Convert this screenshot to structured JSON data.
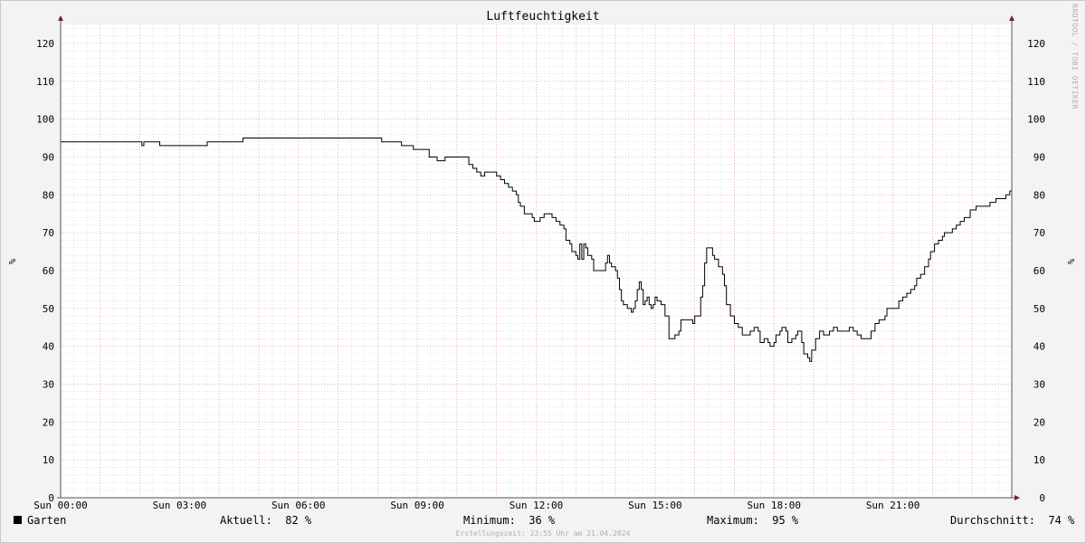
{
  "page": {
    "title": "Luftfeuchtigkeit",
    "credit": "RRDTOOL / TOBI OETIKER",
    "timestamp": "Erstellungszeit: 23:55 Uhr am 21.04.2024"
  },
  "legend": {
    "series_name": "Garten",
    "current": "Aktuell:  82 %",
    "minimum": "Minimum:  36 %",
    "maximum": "Maximum:  95 %",
    "average": "Durchschnitt:  74 %"
  },
  "colors": {
    "background": "#f3f3f3",
    "plot_area": "#ffffff",
    "line": "#000000",
    "major_grid": "#e5a0a0",
    "minor_grid": "#d0d0d0",
    "axis_arrow": "#7f1d1d"
  },
  "chart_data": {
    "type": "line",
    "title": "Luftfeuchtigkeit",
    "ylabel": "%",
    "ylim": [
      0,
      125
    ],
    "yticks": [
      0,
      10,
      20,
      30,
      40,
      50,
      60,
      70,
      80,
      90,
      100,
      110,
      120
    ],
    "xlim": [
      0,
      24
    ],
    "x_unit": "hours",
    "xticks": [
      {
        "x": 0,
        "label": "Sun 00:00"
      },
      {
        "x": 3,
        "label": "Sun 03:00"
      },
      {
        "x": 6,
        "label": "Sun 06:00"
      },
      {
        "x": 9,
        "label": "Sun 09:00"
      },
      {
        "x": 12,
        "label": "Sun 12:00"
      },
      {
        "x": 15,
        "label": "Sun 15:00"
      },
      {
        "x": 18,
        "label": "Sun 18:00"
      },
      {
        "x": 21,
        "label": "Sun 21:00"
      }
    ],
    "grid": true,
    "series": [
      {
        "name": "Garten",
        "color": "#000000",
        "step": true,
        "points": [
          [
            0,
            94
          ],
          [
            2.0,
            94
          ],
          [
            2.05,
            93
          ],
          [
            2.1,
            94
          ],
          [
            2.5,
            94
          ],
          [
            2.5,
            93
          ],
          [
            3.6,
            93
          ],
          [
            3.7,
            94
          ],
          [
            4.6,
            94
          ],
          [
            4.6,
            95
          ],
          [
            8.1,
            95
          ],
          [
            8.1,
            94
          ],
          [
            8.6,
            94
          ],
          [
            8.6,
            93
          ],
          [
            8.9,
            93
          ],
          [
            8.9,
            92
          ],
          [
            9.3,
            92
          ],
          [
            9.3,
            90
          ],
          [
            9.5,
            90
          ],
          [
            9.5,
            89
          ],
          [
            9.7,
            89
          ],
          [
            9.7,
            90
          ],
          [
            10.2,
            90
          ],
          [
            10.3,
            88
          ],
          [
            10.4,
            87
          ],
          [
            10.5,
            86
          ],
          [
            10.6,
            85
          ],
          [
            10.7,
            86
          ],
          [
            10.9,
            86
          ],
          [
            11.0,
            85
          ],
          [
            11.1,
            84
          ],
          [
            11.2,
            83
          ],
          [
            11.3,
            82
          ],
          [
            11.4,
            81
          ],
          [
            11.5,
            80
          ],
          [
            11.55,
            78
          ],
          [
            11.6,
            77
          ],
          [
            11.7,
            75
          ],
          [
            11.9,
            74
          ],
          [
            11.95,
            73
          ],
          [
            12.1,
            73
          ],
          [
            12.1,
            74
          ],
          [
            12.2,
            75
          ],
          [
            12.4,
            74
          ],
          [
            12.5,
            73
          ],
          [
            12.6,
            72
          ],
          [
            12.7,
            71
          ],
          [
            12.75,
            68
          ],
          [
            12.85,
            67
          ],
          [
            12.9,
            65
          ],
          [
            13.0,
            64
          ],
          [
            13.05,
            63
          ],
          [
            13.1,
            67
          ],
          [
            13.15,
            63
          ],
          [
            13.2,
            67
          ],
          [
            13.25,
            66
          ],
          [
            13.3,
            64
          ],
          [
            13.4,
            63
          ],
          [
            13.45,
            60
          ],
          [
            13.7,
            60
          ],
          [
            13.75,
            62
          ],
          [
            13.8,
            64
          ],
          [
            13.85,
            62
          ],
          [
            13.9,
            61
          ],
          [
            14.0,
            60
          ],
          [
            14.05,
            58
          ],
          [
            14.1,
            55
          ],
          [
            14.15,
            52
          ],
          [
            14.2,
            51
          ],
          [
            14.3,
            50
          ],
          [
            14.4,
            49
          ],
          [
            14.45,
            50
          ],
          [
            14.5,
            52
          ],
          [
            14.55,
            55
          ],
          [
            14.6,
            57
          ],
          [
            14.65,
            55
          ],
          [
            14.7,
            51
          ],
          [
            14.75,
            52
          ],
          [
            14.8,
            53
          ],
          [
            14.85,
            51
          ],
          [
            14.9,
            50
          ],
          [
            14.95,
            51
          ],
          [
            15.0,
            53
          ],
          [
            15.05,
            52
          ],
          [
            15.15,
            51
          ],
          [
            15.25,
            48
          ],
          [
            15.35,
            42
          ],
          [
            15.5,
            43
          ],
          [
            15.6,
            44
          ],
          [
            15.65,
            47
          ],
          [
            15.9,
            47
          ],
          [
            15.95,
            46
          ],
          [
            16.0,
            48
          ],
          [
            16.1,
            48
          ],
          [
            16.15,
            53
          ],
          [
            16.2,
            56
          ],
          [
            16.25,
            62
          ],
          [
            16.3,
            66
          ],
          [
            16.4,
            66
          ],
          [
            16.45,
            64
          ],
          [
            16.5,
            63
          ],
          [
            16.6,
            61
          ],
          [
            16.7,
            59
          ],
          [
            16.75,
            56
          ],
          [
            16.8,
            51
          ],
          [
            16.9,
            48
          ],
          [
            17.0,
            46
          ],
          [
            17.1,
            45
          ],
          [
            17.2,
            43
          ],
          [
            17.35,
            43
          ],
          [
            17.4,
            44
          ],
          [
            17.5,
            45
          ],
          [
            17.6,
            44
          ],
          [
            17.65,
            41
          ],
          [
            17.75,
            42
          ],
          [
            17.85,
            41
          ],
          [
            17.9,
            40
          ],
          [
            18.0,
            41
          ],
          [
            18.05,
            43
          ],
          [
            18.15,
            44
          ],
          [
            18.2,
            45
          ],
          [
            18.3,
            44
          ],
          [
            18.35,
            41
          ],
          [
            18.45,
            42
          ],
          [
            18.55,
            43
          ],
          [
            18.6,
            44
          ],
          [
            18.7,
            41
          ],
          [
            18.75,
            38
          ],
          [
            18.85,
            37
          ],
          [
            18.9,
            36
          ],
          [
            18.95,
            39
          ],
          [
            19.05,
            42
          ],
          [
            19.15,
            44
          ],
          [
            19.25,
            43
          ],
          [
            19.4,
            44
          ],
          [
            19.5,
            45
          ],
          [
            19.6,
            44
          ],
          [
            19.85,
            44
          ],
          [
            19.9,
            45
          ],
          [
            20.0,
            44
          ],
          [
            20.1,
            43
          ],
          [
            20.2,
            42
          ],
          [
            20.4,
            42
          ],
          [
            20.45,
            44
          ],
          [
            20.55,
            46
          ],
          [
            20.65,
            47
          ],
          [
            20.8,
            48
          ],
          [
            20.85,
            50
          ],
          [
            21.1,
            50
          ],
          [
            21.15,
            52
          ],
          [
            21.25,
            53
          ],
          [
            21.35,
            54
          ],
          [
            21.45,
            55
          ],
          [
            21.55,
            56
          ],
          [
            21.6,
            58
          ],
          [
            21.7,
            59
          ],
          [
            21.8,
            61
          ],
          [
            21.9,
            63
          ],
          [
            21.95,
            65
          ],
          [
            22.05,
            67
          ],
          [
            22.15,
            68
          ],
          [
            22.25,
            69
          ],
          [
            22.3,
            70
          ],
          [
            22.5,
            71
          ],
          [
            22.6,
            72
          ],
          [
            22.7,
            73
          ],
          [
            22.8,
            74
          ],
          [
            22.95,
            76
          ],
          [
            23.1,
            77
          ],
          [
            23.45,
            78
          ],
          [
            23.6,
            79
          ],
          [
            23.85,
            80
          ],
          [
            23.95,
            81
          ],
          [
            24.0,
            81
          ]
        ]
      }
    ]
  }
}
